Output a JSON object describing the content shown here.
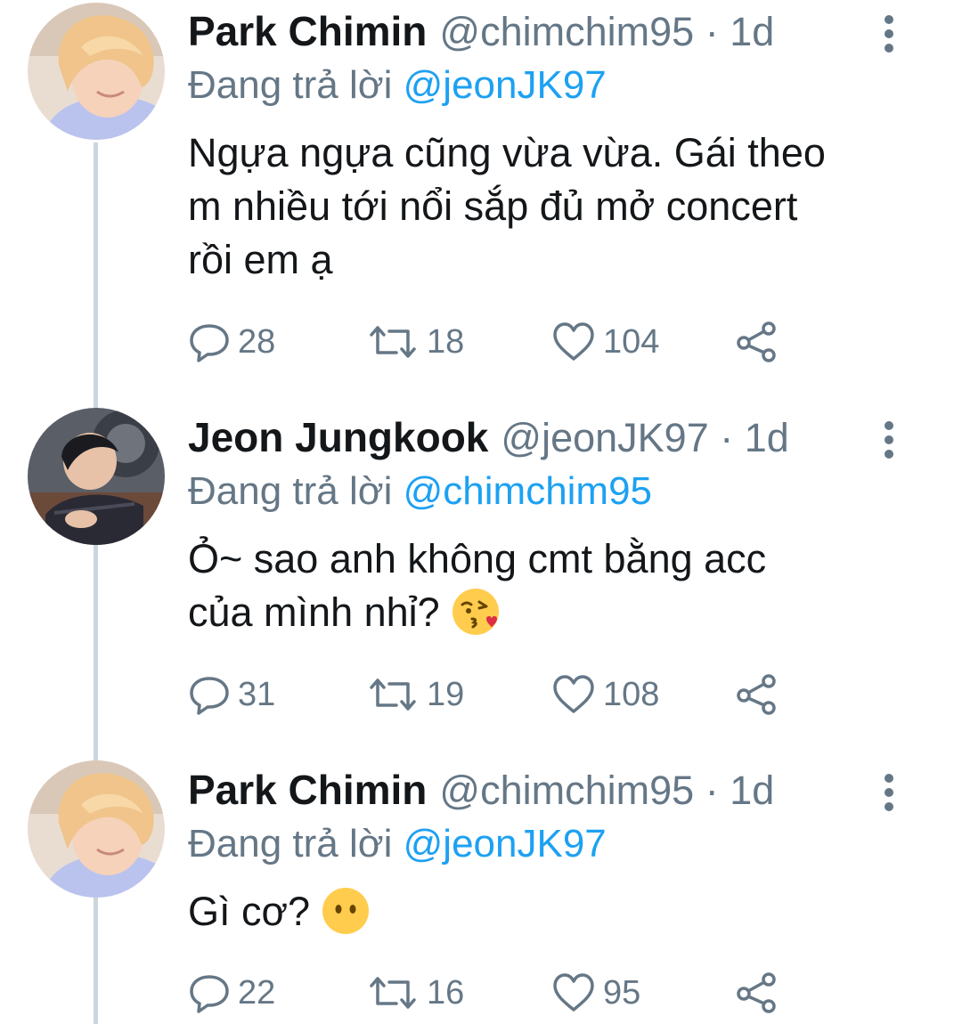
{
  "tweets": [
    {
      "display_name": "Park Chimin",
      "handle": "@chimchim95",
      "time": "1d",
      "reply_label": "Đang trả lời",
      "reply_to": "@jeonJK97",
      "text_lines": [
        "Ngựa ngựa cũng vừa vừa. Gái theo",
        "m nhiều tới nổi sắp đủ mở concert",
        "rồi em ạ"
      ],
      "replies": "28",
      "retweets": "18",
      "likes": "104",
      "avatar_icon": "user-avatar-blonde"
    },
    {
      "display_name": "Jeon Jungkook",
      "handle": "@jeonJK97",
      "time": "1d",
      "reply_label": "Đang trả lời",
      "reply_to": "@chimchim95",
      "text_lines": [
        "Ỏ~ sao anh không cmt bằng acc",
        "của mình nhỉ?"
      ],
      "emoji": "😘",
      "replies": "31",
      "retweets": "19",
      "likes": "108",
      "avatar_icon": "user-avatar-dark-hair"
    },
    {
      "display_name": "Park Chimin",
      "handle": "@chimchim95",
      "time": "1d",
      "reply_label": "Đang trả lời",
      "reply_to": "@jeonJK97",
      "text_lines": [
        "Gì cơ?"
      ],
      "emoji": "😶",
      "replies": "22",
      "retweets": "16",
      "likes": "95",
      "avatar_icon": "user-avatar-blonde"
    }
  ],
  "separator": "·",
  "colors": {
    "text": "#14171a",
    "secondary": "#657786",
    "link": "#1da1f2",
    "thread_line": "#ccd6dd"
  },
  "icons": {
    "reply": "reply-icon",
    "retweet": "retweet-icon",
    "like": "heart-icon",
    "share": "share-icon",
    "more": "more-vertical-icon"
  }
}
